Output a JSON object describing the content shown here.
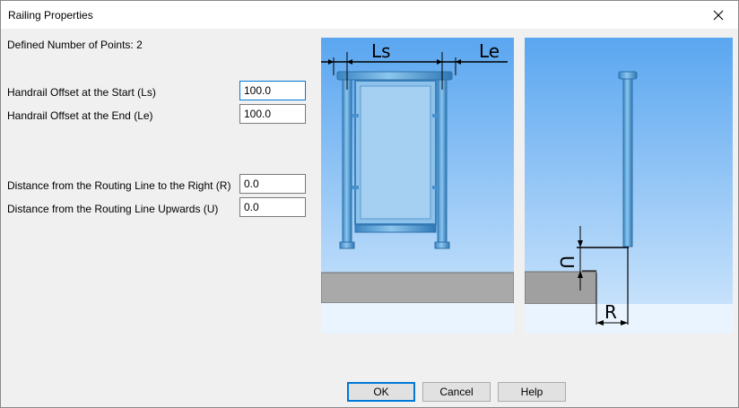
{
  "window": {
    "title": "Railing Properties"
  },
  "info": {
    "defined_points": "Defined Number of Points: 2"
  },
  "fields": {
    "ls_label": "Handrail Offset at the Start (Ls)",
    "ls_value": "100.0",
    "le_label": "Handrail Offset at the End (Le)",
    "le_value": "100.0",
    "r_label": "Distance from the Routing Line to the Right (R)",
    "r_value": "0.0",
    "u_label": "Distance from the Routing Line Upwards (U)",
    "u_value": "0.0"
  },
  "diagram": {
    "ls_tag": "Ls",
    "le_tag": "Le",
    "r_tag": "R",
    "u_tag": "U"
  },
  "buttons": {
    "ok": "OK",
    "cancel": "Cancel",
    "help": "Help"
  },
  "colors": {
    "accent": "#0078d7",
    "rail": "#5fa8dc",
    "sky_top": "#5aa6f0",
    "sky_bottom": "#cfe6fc",
    "slab": "#a9a9a9"
  },
  "icons": {
    "close": "close-icon"
  }
}
